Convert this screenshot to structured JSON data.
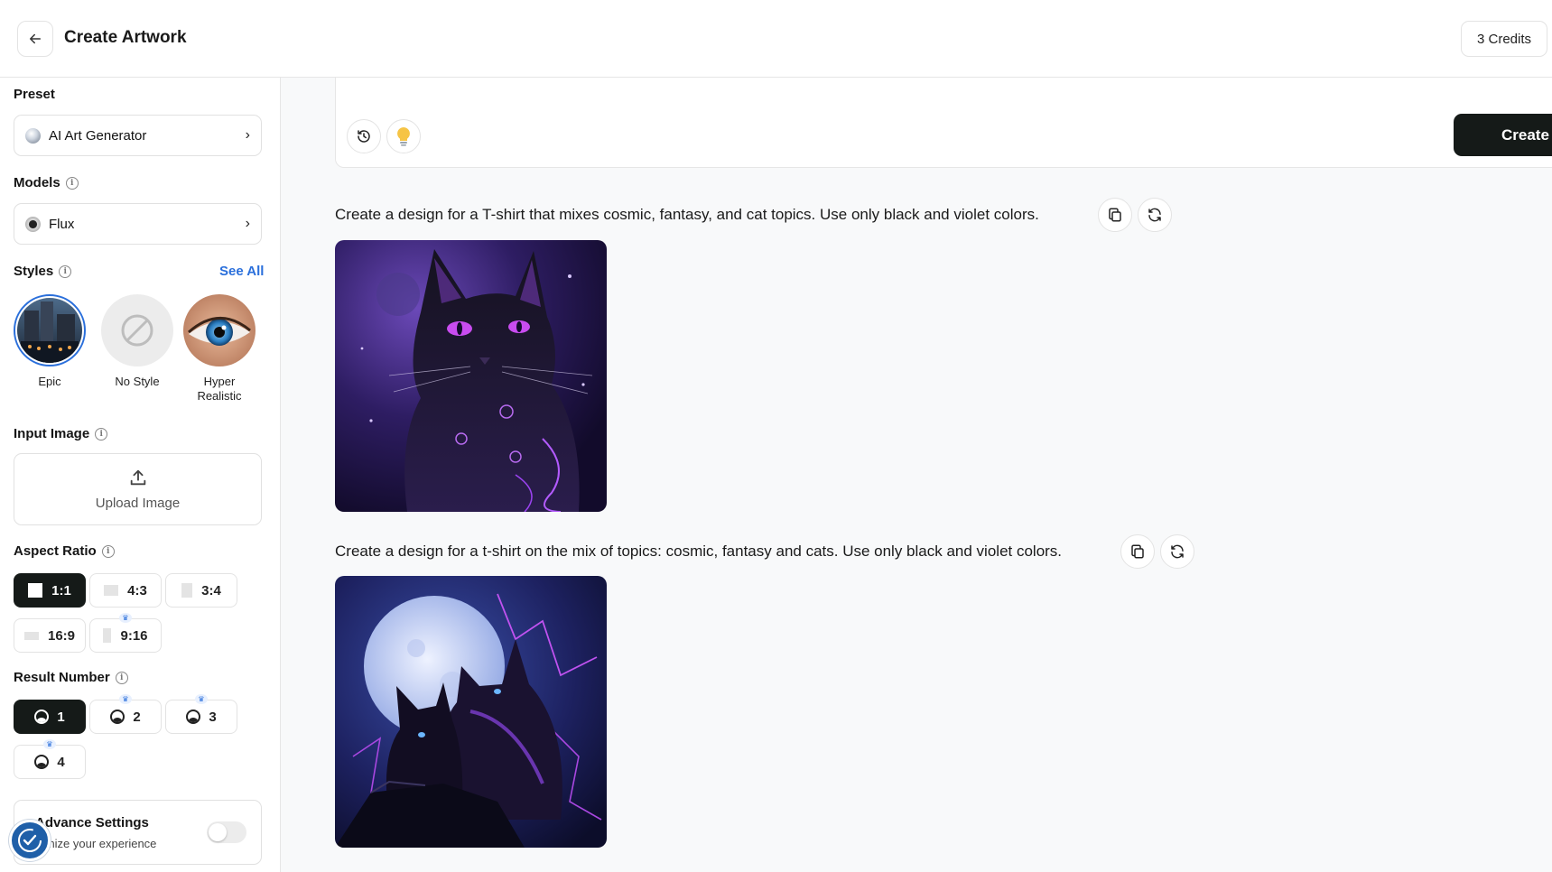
{
  "header": {
    "title": "Create Artwork",
    "credits": "3 Credits"
  },
  "sidebar": {
    "preset": {
      "label": "Preset",
      "value": "AI Art Generator"
    },
    "models": {
      "label": "Models",
      "value": "Flux"
    },
    "styles": {
      "label": "Styles",
      "see_all": "See All",
      "items": [
        {
          "label": "Epic",
          "selected": true
        },
        {
          "label": "No Style",
          "selected": false
        },
        {
          "label": "Hyper Realistic",
          "selected": false
        }
      ]
    },
    "input_image": {
      "label": "Input Image",
      "upload": "Upload Image"
    },
    "aspect_ratio": {
      "label": "Aspect Ratio",
      "options": [
        {
          "label": "1:1",
          "active": true,
          "premium": false
        },
        {
          "label": "4:3",
          "active": false,
          "premium": false
        },
        {
          "label": "3:4",
          "active": false,
          "premium": false
        },
        {
          "label": "16:9",
          "active": false,
          "premium": false
        },
        {
          "label": "9:16",
          "active": false,
          "premium": true
        }
      ]
    },
    "result_number": {
      "label": "Result Number",
      "options": [
        {
          "label": "1",
          "active": true,
          "premium": false
        },
        {
          "label": "2",
          "active": false,
          "premium": true
        },
        {
          "label": "3",
          "active": false,
          "premium": true
        },
        {
          "label": "4",
          "active": false,
          "premium": true
        }
      ]
    },
    "advanced": {
      "title": "Advance Settings",
      "subtitle": "tomize your experience",
      "enabled": false
    }
  },
  "prompt_panel": {
    "create_label": "Create",
    "history_icon": "history-icon",
    "idea_icon": "lightbulb-icon"
  },
  "results": [
    {
      "prompt": "Create a design for a T-shirt that mixes cosmic, fantasy, and cat topics. Use only black and violet colors.",
      "image": "black cat with violet glowing eyes on cosmic background"
    },
    {
      "prompt": "Create a design for a t-shirt on the mix of topics: cosmic, fantasy and cats. Use only black and violet colors.",
      "image": "two black cats under a full moon with violet lightning"
    }
  ],
  "colors": {
    "accent": "#2a6fdb",
    "dark": "#151a18",
    "background": "#f8f9fa"
  }
}
